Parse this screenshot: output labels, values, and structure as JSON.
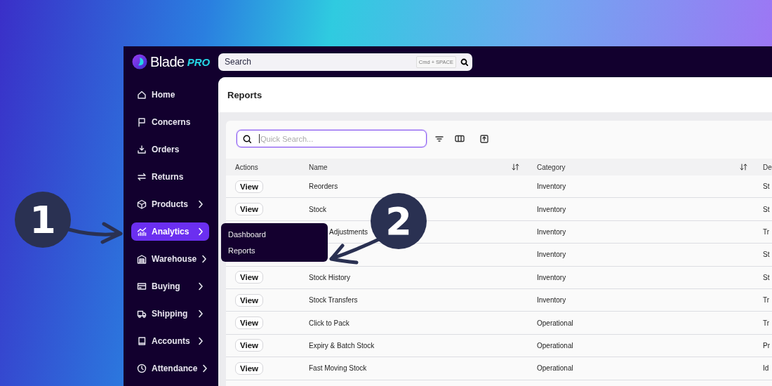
{
  "logo": {
    "name": "Blade",
    "suffix": "PRO"
  },
  "search": {
    "placeholder": "Search",
    "shortcut": "Cmd + SPACE"
  },
  "sidebar": {
    "items": [
      {
        "label": "Home",
        "expandable": false,
        "selected": false
      },
      {
        "label": "Concerns",
        "expandable": false,
        "selected": false
      },
      {
        "label": "Orders",
        "expandable": false,
        "selected": false
      },
      {
        "label": "Returns",
        "expandable": false,
        "selected": false
      },
      {
        "label": "Products",
        "expandable": true,
        "selected": false
      },
      {
        "label": "Analytics",
        "expandable": true,
        "selected": true
      },
      {
        "label": "Warehouse",
        "expandable": true,
        "selected": false
      },
      {
        "label": "Buying",
        "expandable": true,
        "selected": false
      },
      {
        "label": "Shipping",
        "expandable": true,
        "selected": false
      },
      {
        "label": "Accounts",
        "expandable": true,
        "selected": false
      },
      {
        "label": "Attendance",
        "expandable": true,
        "selected": false
      }
    ]
  },
  "page": {
    "title": "Reports"
  },
  "quick_search": {
    "placeholder": "Quick Search...",
    "focused": true
  },
  "table": {
    "columns": [
      {
        "label": "Actions",
        "sortable": false
      },
      {
        "label": "Name",
        "sortable": true
      },
      {
        "label": "Category",
        "sortable": true
      },
      {
        "label": "De"
      }
    ],
    "rows": [
      {
        "action": "View",
        "name": "Reorders",
        "category": "Inventory",
        "column_4": "St"
      },
      {
        "action": "View",
        "name": "Stock",
        "category": "Inventory",
        "column_4": "St"
      },
      {
        "name": "Adjustments",
        "category": "Inventory",
        "column_4": "Tr"
      },
      {
        "category": "Inventory",
        "column_4": "St"
      },
      {
        "action": "View",
        "name": "Stock History",
        "category": "Inventory",
        "column_4": "St"
      },
      {
        "action": "View",
        "name": "Stock Transfers",
        "category": "Inventory",
        "column_4": "Tr"
      },
      {
        "action": "View",
        "name": "Click to Pack",
        "category": "Operational",
        "column_4": "Tr"
      },
      {
        "action": "View",
        "name": "Expiry & Batch Stock",
        "category": "Operational",
        "column_4": "Pr"
      },
      {
        "action": "View",
        "name": "Fast Moving Stock",
        "category": "Operational",
        "column_4": "Id"
      }
    ]
  },
  "flyout": {
    "items": [
      {
        "label": "Dashboard"
      },
      {
        "label": "Reports"
      }
    ]
  },
  "callouts": [
    {
      "number": "1"
    },
    {
      "number": "2"
    }
  ]
}
